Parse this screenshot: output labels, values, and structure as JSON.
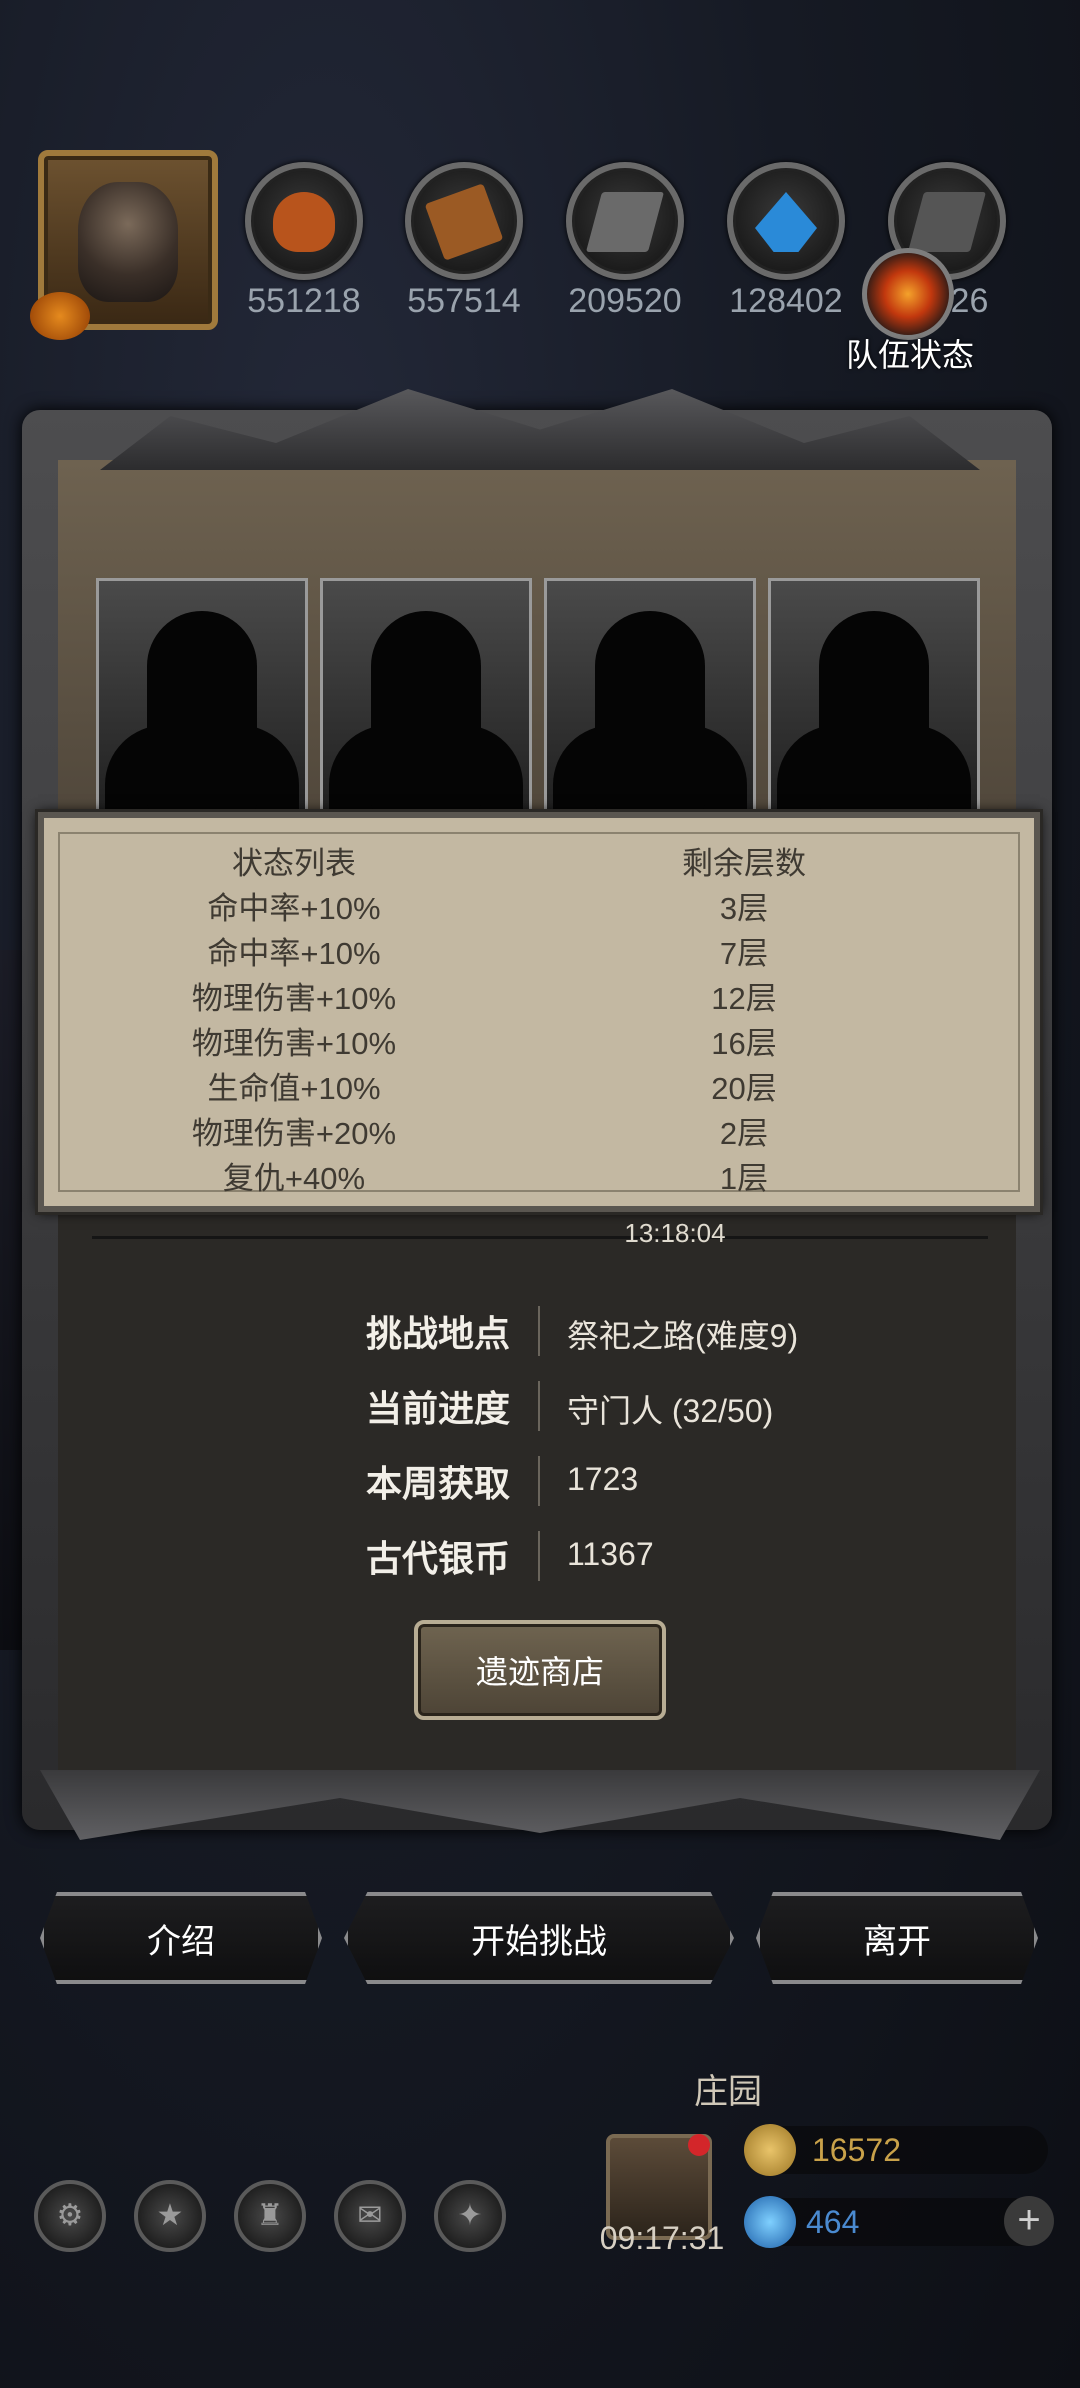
{
  "top": {
    "resources": [
      {
        "icon": "meat-icon",
        "value": "551218",
        "color": "#b8541c"
      },
      {
        "icon": "wood-icon",
        "value": "557514",
        "color": "#9b5a24"
      },
      {
        "icon": "iron-icon",
        "value": "209520",
        "color": "#6a6a6a"
      },
      {
        "icon": "crystal-icon",
        "value": "128402",
        "color": "#2a8ad8"
      },
      {
        "icon": "stone-icon",
        "value": "926",
        "color": "#555555"
      }
    ],
    "team_status_label": "队伍状态"
  },
  "status_list": {
    "header_name": "状态列表",
    "header_layers": "剩余层数",
    "rows": [
      {
        "name": "命中率+10%",
        "layers": "3层"
      },
      {
        "name": "命中率+10%",
        "layers": "7层"
      },
      {
        "name": "物理伤害+10%",
        "layers": "12层"
      },
      {
        "name": "物理伤害+10%",
        "layers": "16层"
      },
      {
        "name": "生命值+10%",
        "layers": "20层"
      },
      {
        "name": "物理伤害+20%",
        "layers": "2层"
      },
      {
        "name": "复仇+40%",
        "layers": "1层"
      }
    ]
  },
  "timer": "13:18:04",
  "info": [
    {
      "label": "挑战地点",
      "value": "祭祀之路(难度9)"
    },
    {
      "label": "当前进度",
      "value": "守门人 (32/50)"
    },
    {
      "label": "本周获取",
      "value": "1723"
    },
    {
      "label": "古代银币",
      "value": "11367"
    }
  ],
  "shop_button": "遗迹商店",
  "buttons": {
    "intro": "介绍",
    "start": "开始挑战",
    "leave": "离开"
  },
  "manor": {
    "label": "庄园",
    "gift_timer": "09:17:31",
    "gold": "16572",
    "gems": "464"
  }
}
